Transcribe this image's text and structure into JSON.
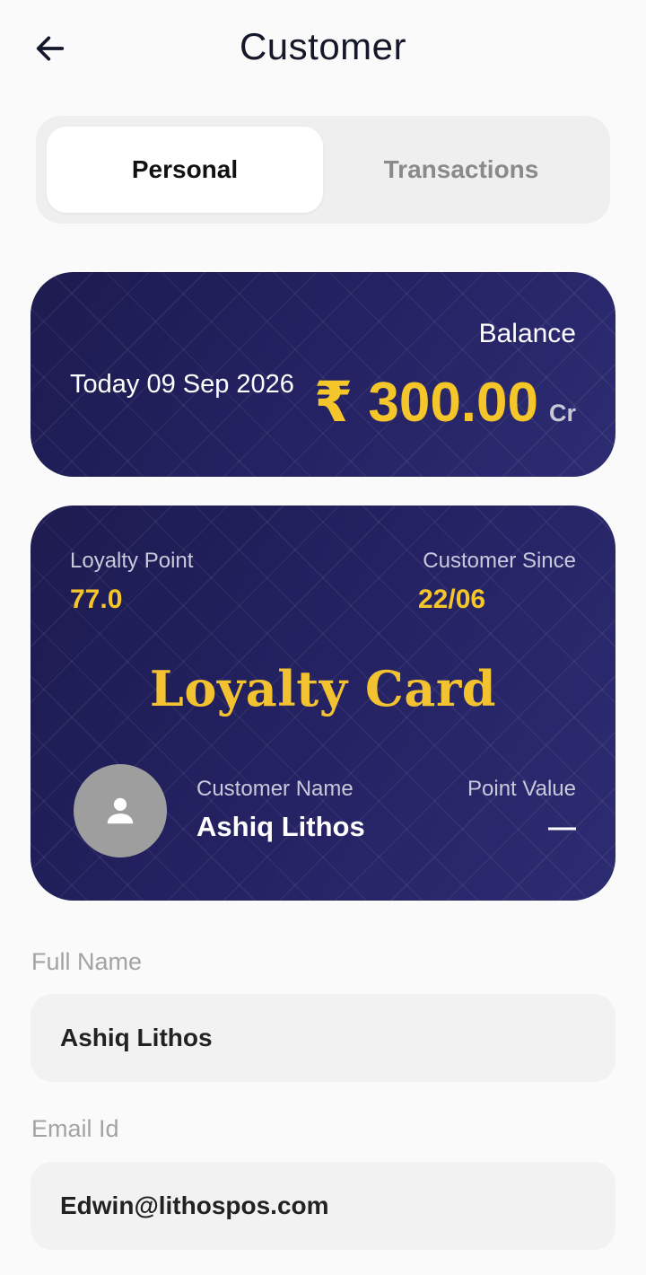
{
  "header": {
    "title": "Customer",
    "back_icon": "arrow-left-icon"
  },
  "tabs": [
    {
      "label": "Personal",
      "active": true
    },
    {
      "label": "Transactions",
      "active": false
    }
  ],
  "balance_card": {
    "label": "Balance",
    "date_text": "Today 09 Sep 2026",
    "amount": "₹ 300.00",
    "suffix": "Cr",
    "accent_color": "#f5c629"
  },
  "loyalty_card": {
    "loyalty_point_label": "Loyalty Point",
    "loyalty_point_value": "77.0",
    "customer_since_label": "Customer Since",
    "customer_since_value": "22/06",
    "title": "Loyalty Card",
    "customer_name_label": "Customer Name",
    "customer_name_value": "Ashiq Lithos",
    "point_value_label": "Point Value",
    "point_value_value": "—",
    "avatar_icon": "person-icon"
  },
  "form": {
    "full_name": {
      "label": "Full Name",
      "value": "Ashiq Lithos"
    },
    "email": {
      "label": "Email Id",
      "value": "Edwin@lithospos.com"
    }
  }
}
